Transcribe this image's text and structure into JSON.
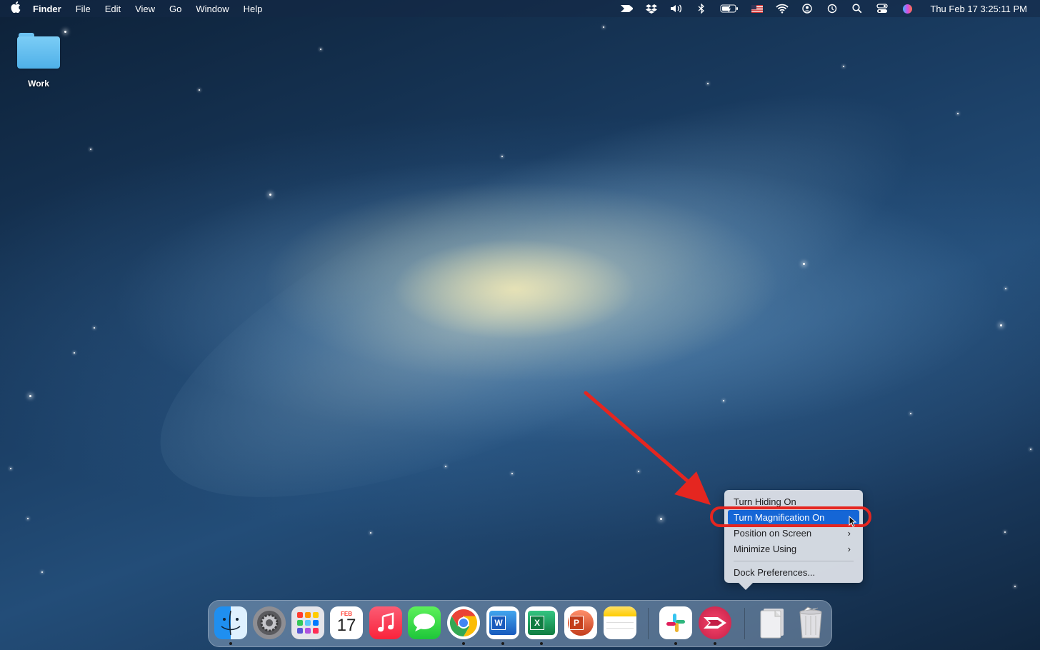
{
  "menubar": {
    "app_name": "Finder",
    "menus": [
      "File",
      "Edit",
      "View",
      "Go",
      "Window",
      "Help"
    ],
    "status_icons": [
      "dash-icon",
      "dropbox-icon",
      "volume-icon",
      "bluetooth-icon",
      "battery-icon",
      "us-flag-icon",
      "wifi-icon",
      "user-icon",
      "time-machine-icon",
      "spotlight-icon",
      "control-center-icon",
      "siri-icon"
    ],
    "clock": "Thu Feb 17  3:25:11 PM"
  },
  "desktop": {
    "folder_label": "Work"
  },
  "context_menu": {
    "items": [
      {
        "label": "Turn Hiding On",
        "submenu": false,
        "selected": false
      },
      {
        "label": "Turn Magnification On",
        "submenu": false,
        "selected": true
      },
      {
        "label": "Position on Screen",
        "submenu": true,
        "selected": false
      },
      {
        "label": "Minimize Using",
        "submenu": true,
        "selected": false
      },
      {
        "label": "Dock Preferences...",
        "submenu": false,
        "selected": false
      }
    ],
    "highlight_color": "#e52620",
    "selection_color": "#1566d6"
  },
  "calendar": {
    "month": "FEB",
    "day": "17"
  },
  "dock": {
    "apps": [
      {
        "name": "finder-icon",
        "running": true
      },
      {
        "name": "system-preferences-icon",
        "running": false
      },
      {
        "name": "launchpad-icon",
        "running": false
      },
      {
        "name": "calendar-icon",
        "running": false
      },
      {
        "name": "music-icon",
        "running": false
      },
      {
        "name": "messages-icon",
        "running": false
      },
      {
        "name": "chrome-icon",
        "running": true
      },
      {
        "name": "word-icon",
        "running": true
      },
      {
        "name": "excel-icon",
        "running": true
      },
      {
        "name": "powerpoint-icon",
        "running": false
      },
      {
        "name": "notes-icon",
        "running": false
      },
      {
        "name": "slack-icon",
        "running": true
      },
      {
        "name": "dash-app-icon",
        "running": true
      },
      {
        "name": "document-icon",
        "running": false
      },
      {
        "name": "trash-icon",
        "running": false
      }
    ]
  }
}
